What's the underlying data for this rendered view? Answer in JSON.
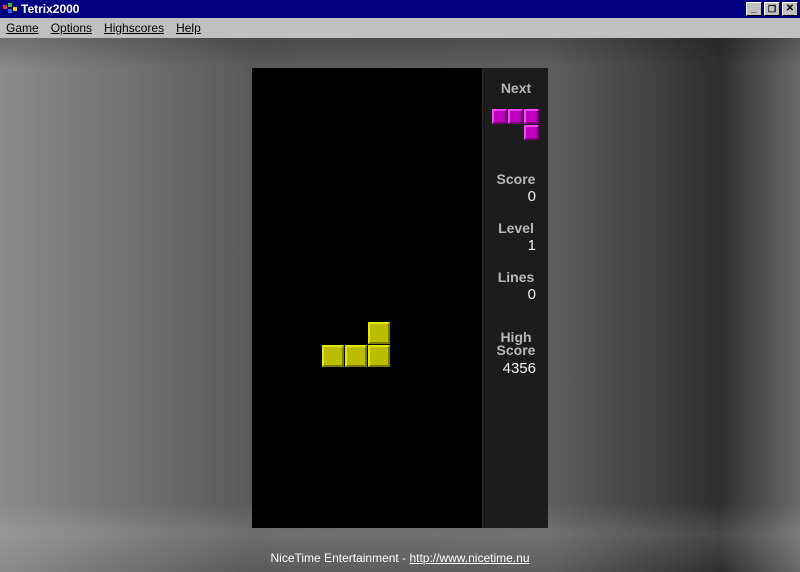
{
  "window": {
    "title": "Tetrix2000",
    "controls": [
      "_",
      "❐",
      "✕"
    ]
  },
  "menu": {
    "items": [
      {
        "label": "Game"
      },
      {
        "label": "Options"
      },
      {
        "label": "Highscores"
      },
      {
        "label": "Help"
      }
    ]
  },
  "panel": {
    "next_label": "Next",
    "score_label": "Score",
    "score_value": "0",
    "level_label": "Level",
    "level_value": "1",
    "lines_label": "Lines",
    "lines_value": "0",
    "high_label_1": "High",
    "high_label_2": "Score",
    "high_value": "4356"
  },
  "pieces": {
    "current": {
      "shape": "L",
      "color": "#bcbc00"
    },
    "next": {
      "shape": "J",
      "color": "#c000c0"
    }
  },
  "footer": {
    "text": "NiceTime Entertainment - ",
    "link": "http://www.nicetime.nu"
  }
}
